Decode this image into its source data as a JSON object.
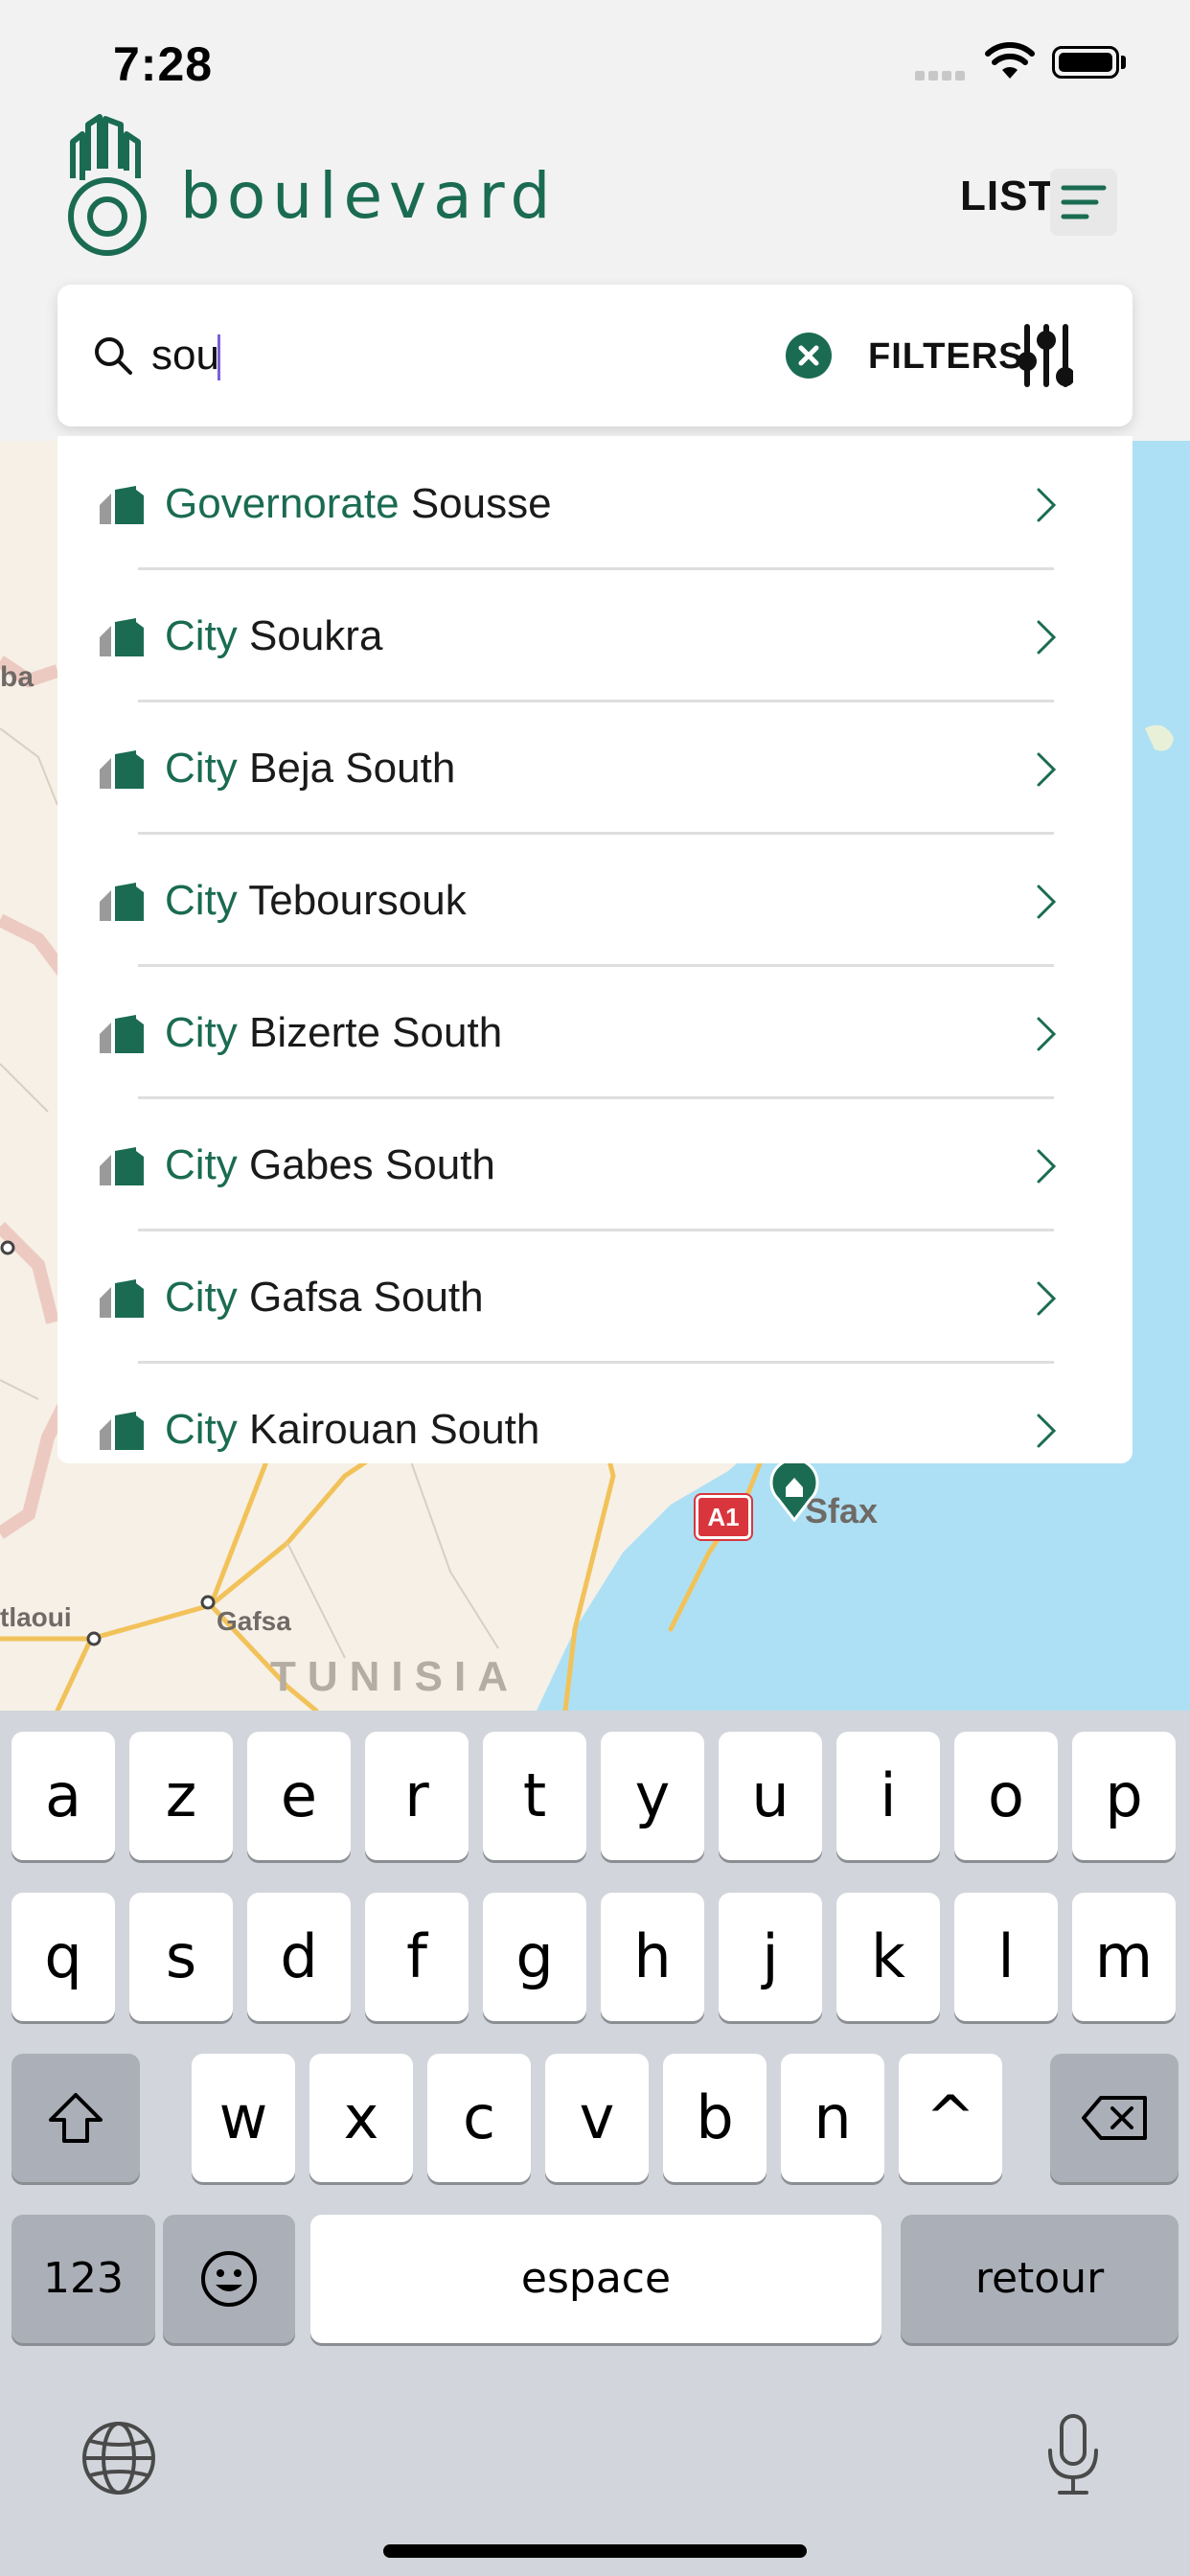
{
  "status_bar": {
    "time": "7:28"
  },
  "header": {
    "brand": "boulevard",
    "list_label": "LIST"
  },
  "search": {
    "query": "sou",
    "filters_label": "FILTERS"
  },
  "suggestions": [
    {
      "type": "Governorate",
      "name": "Sousse"
    },
    {
      "type": "City",
      "name": "Soukra"
    },
    {
      "type": "City",
      "name": "Beja South"
    },
    {
      "type": "City",
      "name": "Teboursouk"
    },
    {
      "type": "City",
      "name": "Bizerte South"
    },
    {
      "type": "City",
      "name": "Gabes South"
    },
    {
      "type": "City",
      "name": "Gafsa South"
    },
    {
      "type": "City",
      "name": "Kairouan South"
    }
  ],
  "map": {
    "labels": {
      "sfax": "Sfax",
      "gafsa": "Gafsa",
      "tunisia": "TUNISIA",
      "tlaoui": "tlaoui",
      "ba": "ba",
      "road": "A1"
    }
  },
  "keyboard": {
    "row1": [
      "a",
      "z",
      "e",
      "r",
      "t",
      "y",
      "u",
      "i",
      "o",
      "p"
    ],
    "row2": [
      "q",
      "s",
      "d",
      "f",
      "g",
      "h",
      "j",
      "k",
      "l",
      "m"
    ],
    "row3": [
      "w",
      "x",
      "c",
      "v",
      "b",
      "n",
      "^"
    ],
    "numbers_key": "123",
    "space_key": "espace",
    "return_key": "retour"
  },
  "colors": {
    "brand": "#1a6b52",
    "map_land": "#f6f0e6",
    "map_sea": "#ade0f4",
    "road": "#f2c25a"
  }
}
